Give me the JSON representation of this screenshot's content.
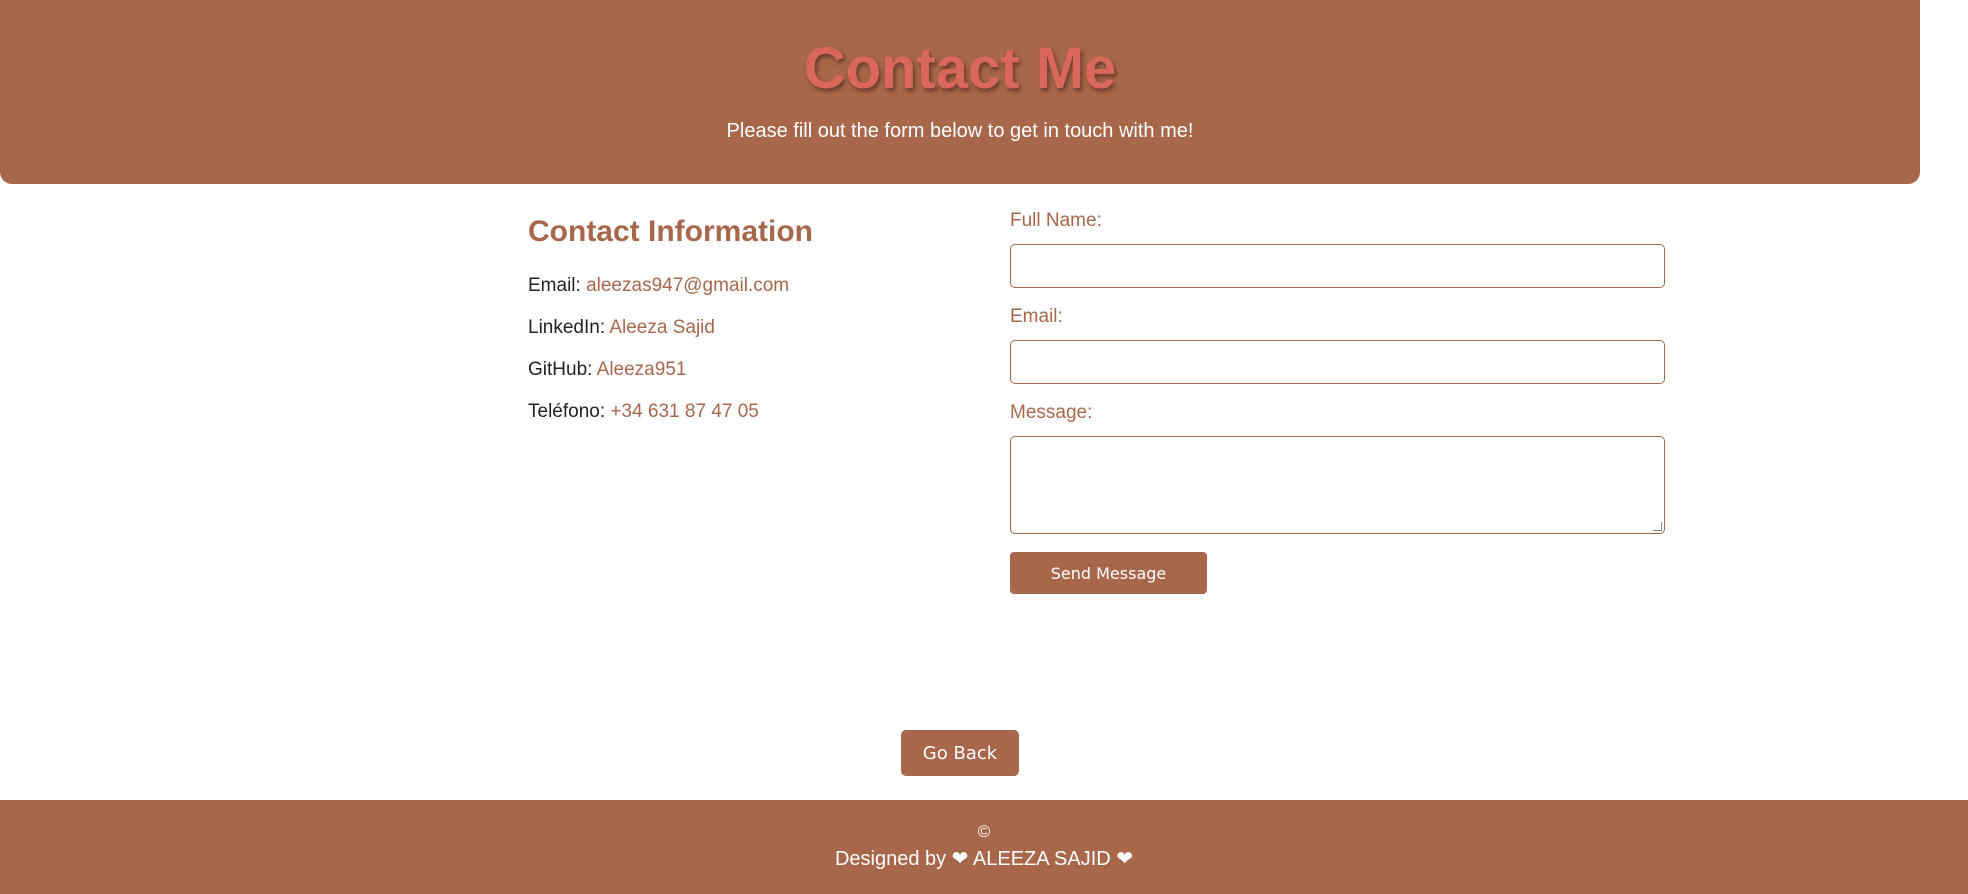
{
  "header": {
    "title": "Contact Me",
    "subtitle": "Please fill out the form below to get in touch with me!"
  },
  "contact_info": {
    "heading": "Contact Information",
    "items": [
      {
        "label": "Email: ",
        "value": "aleezas947@gmail.com"
      },
      {
        "label": "LinkedIn: ",
        "value": "Aleeza Sajid"
      },
      {
        "label": "GitHub: ",
        "value": "Aleeza951"
      },
      {
        "label": "Teléfono: ",
        "value": "+34 631 87 47 05"
      }
    ]
  },
  "form": {
    "full_name_label": "Full Name:",
    "full_name_value": "",
    "email_label": "Email:",
    "email_value": "",
    "message_label": "Message:",
    "message_value": "",
    "submit_label": "Send Message"
  },
  "go_back_label": "Go Back",
  "footer": {
    "copyright": "©",
    "credit": "Designed by ❤ ALEEZA SAJID ❤"
  },
  "colors": {
    "brand": "#a8674b",
    "title": "#d9675c"
  }
}
